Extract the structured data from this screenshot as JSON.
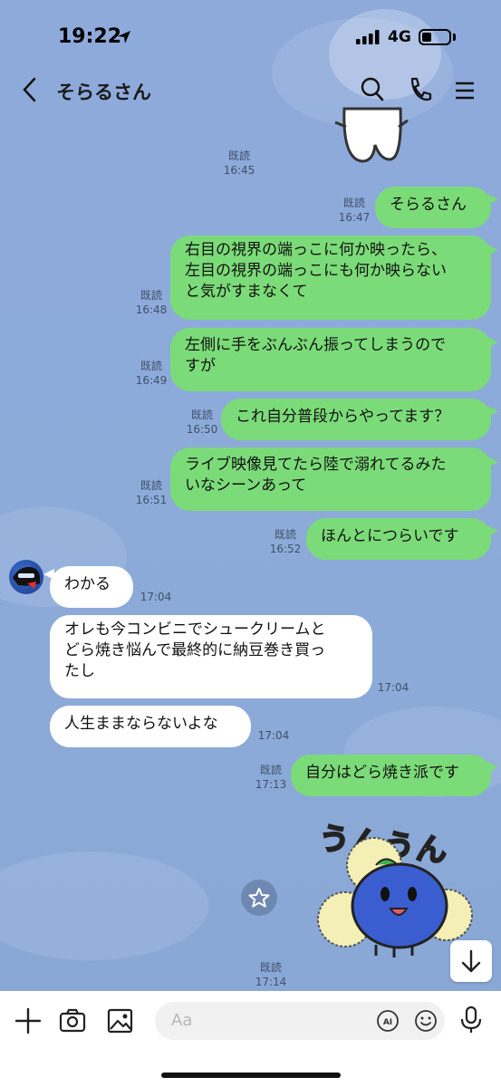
{
  "status": {
    "time": "19:22",
    "network": "4G"
  },
  "header": {
    "title": "そらるさん"
  },
  "messages": [
    {
      "read": "既読",
      "time": "16:45"
    },
    {
      "read": "既読",
      "time": "16:47",
      "text": "そらるさん"
    },
    {
      "read": "既読",
      "time": "16:48",
      "text": [
        "右目の視界の端っこに何か映ったら、",
        "左目の視界の端っこにも何か映らない",
        "と気がすまなくて"
      ]
    },
    {
      "read": "既読",
      "time": "16:49",
      "text": [
        "左側に手をぶんぶん振ってしまうので",
        "すが"
      ]
    },
    {
      "read": "既読",
      "time": "16:50",
      "text": "これ自分普段からやってます？"
    },
    {
      "read": "既読",
      "time": "16:51",
      "text": [
        "ライブ映像見てたら陸で溺れてるみた",
        "いなシーンあって"
      ]
    },
    {
      "read": "既読",
      "time": "16:52",
      "text": "ほんとにつらいです"
    },
    {
      "time": "17:04",
      "text": "わかる"
    },
    {
      "time": "17:04",
      "text": [
        "オレも今コンビニでシュークリームと",
        "どら焼き悩んで最終的に納豆巻き買っ",
        "たし"
      ]
    },
    {
      "time": "17:04",
      "text": "人生ままならないよな"
    },
    {
      "read": "既読",
      "time": "17:13",
      "text": "自分はどら焼き派です"
    },
    {
      "read": "既読",
      "time": "17:14"
    }
  ],
  "sticker": {
    "text": "うんうん"
  },
  "input": {
    "placeholder": "Aa",
    "ai_label": "AI"
  }
}
